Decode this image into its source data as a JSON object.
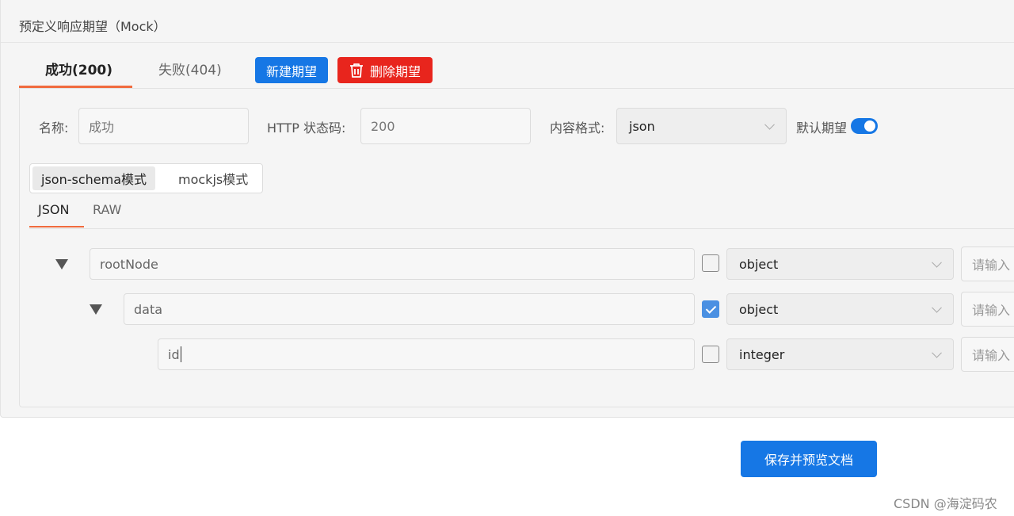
{
  "panel": {
    "title": "预定义响应期望（Mock）"
  },
  "tabs": [
    {
      "label": "成功(200)",
      "active": true
    },
    {
      "label": "失败(404)",
      "active": false
    }
  ],
  "actions": {
    "new_label": "新建期望",
    "delete_label": "删除期望"
  },
  "form": {
    "name_label": "名称:",
    "name_value": "成功",
    "status_label": "HTTP 状态码:",
    "status_value": "200",
    "content_label": "内容格式:",
    "content_value": "json",
    "default_label": "默认期望",
    "default_on": true
  },
  "modes": [
    {
      "label": "json-schema模式",
      "active": true
    },
    {
      "label": "mockjs模式",
      "active": false
    }
  ],
  "subtabs": [
    {
      "label": "JSON",
      "active": true
    },
    {
      "label": "RAW",
      "active": false
    }
  ],
  "schema_rows": [
    {
      "name": "rootNode",
      "required": false,
      "type": "object",
      "description_placeholder": "请输入",
      "expanded": true
    },
    {
      "name": "data",
      "required": true,
      "type": "object",
      "description_placeholder": "请输入",
      "expanded": true
    },
    {
      "name": "id",
      "required": false,
      "type": "integer",
      "description_placeholder": "请输入"
    }
  ],
  "footer": {
    "save_label": "保存并预览文档"
  },
  "watermark": "CSDN @海淀码农",
  "colors": {
    "primary": "#1677e5",
    "danger": "#e8251d",
    "accent": "#f06b3e"
  }
}
